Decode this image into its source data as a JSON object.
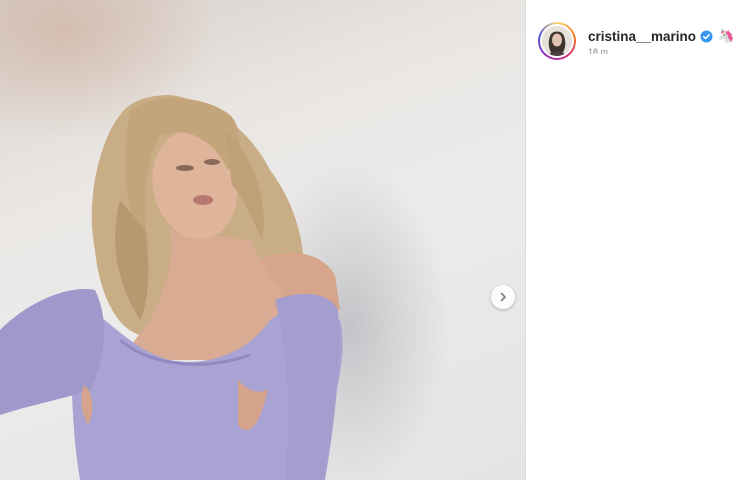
{
  "post": {
    "username": "cristina__marino",
    "badge_emoji": "🦄",
    "timestamp": "18 m"
  },
  "media": {
    "next_icon": "chevron-right-icon"
  },
  "colors": {
    "verified_blue": "#3897f0",
    "top_lavender": "#a9a3d3",
    "username_text": "#262626"
  }
}
